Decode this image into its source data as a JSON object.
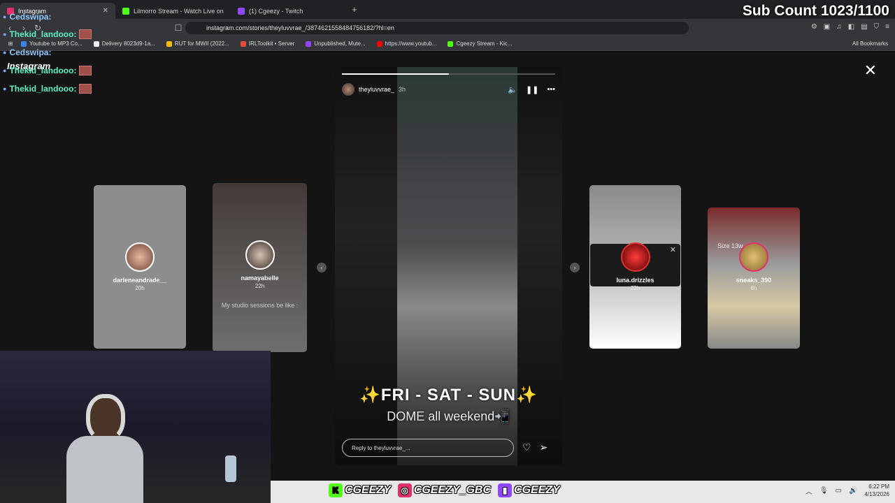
{
  "tabs": [
    {
      "label": "Instagram",
      "active": true,
      "color": "#e1306c"
    },
    {
      "label": "Lilmorro Stream - Watch Live on",
      "active": false,
      "color": "#53fc18"
    },
    {
      "label": "(1) Cgeezy - Twitch",
      "active": false,
      "color": "#9146ff"
    }
  ],
  "url": "instagram.com/stories/theyluvvrae_/3874621558484756182/?hl=en",
  "bookmarks": [
    {
      "label": "Youtube to MP3 Co...",
      "color": "#3b82f6"
    },
    {
      "label": "Delivery 8023d9-1a...",
      "color": "#eee"
    },
    {
      "label": "RUT for MWII (2022...",
      "color": "#fbbc05"
    },
    {
      "label": "IRLToolkit • Server",
      "color": "#e74c3c"
    },
    {
      "label": "Unpublished, Mute...",
      "color": "#9146ff"
    },
    {
      "label": "https://www.youtub...",
      "color": "#ff0000"
    },
    {
      "label": "Cgeezy Stream - Kic...",
      "color": "#53fc18"
    }
  ],
  "all_bookmarks": "All Bookmarks",
  "overlay": {
    "sub_count": "Sub Count 1023/1100",
    "chat": [
      {
        "user": "Cedswipa:",
        "style": "blue"
      },
      {
        "user": "Thekid_landooo:",
        "style": "green"
      },
      {
        "user": "Cedswipa:",
        "style": "blue"
      },
      {
        "user": "Thekid_landooo:",
        "style": "green"
      },
      {
        "user": "Thekid_landooo:",
        "style": "green"
      }
    ],
    "instagram_text": "Instagram"
  },
  "story": {
    "username": "theyluvvrae_",
    "time": "3h",
    "progress": 0.5,
    "caption_main": "✨FRI - SAT - SUN✨",
    "caption_sub": "DOME all weekend📲",
    "reply_placeholder": "Reply to theyluvvrae_..."
  },
  "side_stories": [
    {
      "name": "darleneandrade__",
      "time": "20h"
    },
    {
      "name": "namayabelle",
      "time": "22h",
      "text": "My studio sessions be like :"
    },
    {
      "name": "luna.drizzles",
      "time": "22h"
    },
    {
      "name": "sneaks_390",
      "time": "8h",
      "text": "Size 13w"
    }
  ],
  "socials": [
    {
      "label": "CGEEZY",
      "icon": "kick-icon",
      "color": "#53fc18"
    },
    {
      "label": "CGEEZY_GBC",
      "icon": "instagram-icon",
      "color": "#e1306c"
    },
    {
      "label": "CGEEZY",
      "icon": "twitch-icon",
      "color": "#9146ff"
    }
  ],
  "clock": {
    "time": "6:22 PM",
    "date": "4/13/2026"
  }
}
